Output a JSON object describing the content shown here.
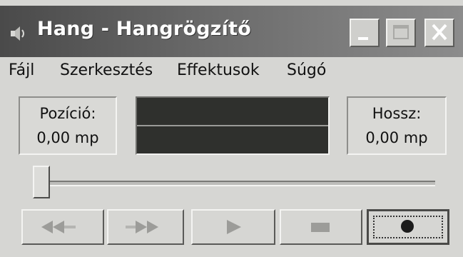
{
  "window": {
    "title": "Hang - Hangrögzítő"
  },
  "titlebar_buttons": [
    "minimize",
    "maximize",
    "close"
  ],
  "menu": [
    {
      "label": "Fájl"
    },
    {
      "label": "Szerkesztés"
    },
    {
      "label": "Effektusok"
    },
    {
      "label": "Súgó"
    }
  ],
  "position": {
    "label": "Pozíció:",
    "value": "0,00 mp"
  },
  "length": {
    "label": "Hossz:",
    "value": "0,00 mp"
  },
  "seek": {
    "value": 0
  },
  "controls": [
    "rewind",
    "fast-forward",
    "play",
    "stop",
    "record"
  ],
  "colors": {
    "title_gradient_start": "#4a4a4a",
    "title_gradient_end": "#8c8c8c",
    "waveform_bg": "#2f302d",
    "record_dot": "#1c1c1c"
  },
  "icons": {
    "app": "speaker-icon",
    "rewind": "rewind-icon",
    "fast_forward": "fast-forward-icon",
    "play": "play-icon",
    "stop": "stop-icon",
    "record": "record-icon"
  }
}
